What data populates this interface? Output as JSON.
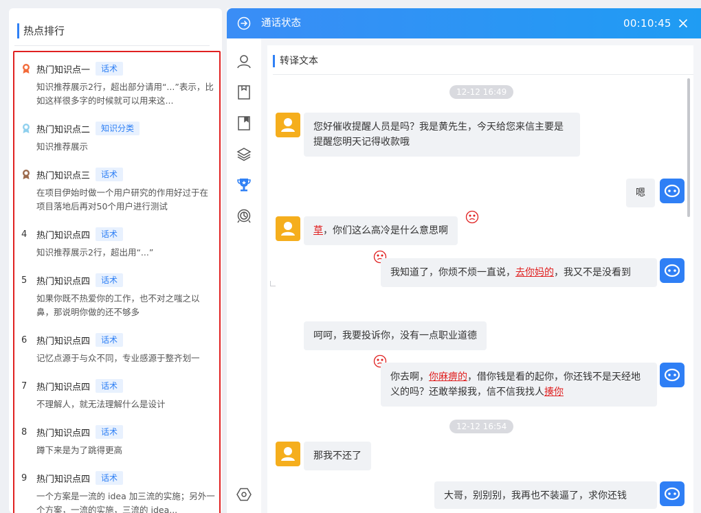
{
  "hot_ranking": {
    "title": "热点排行",
    "items": [
      {
        "rank": "",
        "medal": "gold-medal-icon",
        "title": "热门知识点一",
        "tag": "话术",
        "desc": "知识推荐展示2行，超出部分请用“...”表示，比如这样很多字的时候就可以用来这..."
      },
      {
        "rank": "",
        "medal": "silver-medal-icon",
        "title": "热门知识点二",
        "tag": "知识分类",
        "desc": "知识推荐展示"
      },
      {
        "rank": "",
        "medal": "bronze-medal-icon",
        "title": "热门知识点三",
        "tag": "话术",
        "desc": "在项目伊始时做一个用户研究的作用好过于在项目落地后再对50个用户进行测试"
      },
      {
        "rank": "4",
        "title": "热门知识点四",
        "tag": "话术",
        "desc": "知识推荐展示2行，超出用“...”"
      },
      {
        "rank": "5",
        "title": "热门知识点四",
        "tag": "话术",
        "desc": "如果你既不热爱你的工作，也不对之嗤之以鼻，那说明你做的还不够多"
      },
      {
        "rank": "6",
        "title": "热门知识点四",
        "tag": "话术",
        "desc": "记忆点源于与众不同，专业感源于整齐划一"
      },
      {
        "rank": "7",
        "title": "热门知识点四",
        "tag": "话术",
        "desc": "不理解人，就无法理解什么是设计"
      },
      {
        "rank": "8",
        "title": "热门知识点四",
        "tag": "话术",
        "desc": "蹲下来是为了跳得更高"
      },
      {
        "rank": "9",
        "title": "热门知识点四",
        "tag": "话术",
        "desc": "一个方案是一流的 idea 加三流的实施；另外一个方案，一流的实施，三流的 idea..."
      }
    ]
  },
  "call": {
    "title": "通话状态",
    "timer": "00:10:45",
    "colors": {
      "header_start": "#3a8df6",
      "header_end": "#1f9cf3",
      "accent": "#2f80f5",
      "sensitive": "#e02020"
    }
  },
  "toolbar": {
    "icons": [
      "user-icon",
      "bookmark-icon",
      "book-icon",
      "layers-icon",
      "trophy-icon",
      "headset-icon",
      "settings-hex-icon"
    ]
  },
  "transcript": {
    "title": "转译文本",
    "time_1": "12-12 16:49",
    "time_2": "12-12 16:54",
    "messages": [
      {
        "speaker": "customer",
        "parts": [
          "您好催收提醒人员是吗？我是黄先生，今天给您来信主要是提醒您明天记得收款哦"
        ]
      },
      {
        "speaker": "agent",
        "parts": [
          "嗯"
        ]
      },
      {
        "speaker": "customer",
        "sensitive": true,
        "parts": [
          "草",
          "，你们这么高冷是什么意思啊"
        ]
      },
      {
        "speaker": "agent",
        "sensitive": true,
        "parts": [
          "我知道了，你烦不烦一直说，",
          "去你妈的",
          "，我又不是没看到"
        ]
      },
      {
        "speaker": "customer",
        "parts": [
          "呵呵，我要投诉你，没有一点职业道德"
        ]
      },
      {
        "speaker": "agent",
        "sensitive": true,
        "parts": [
          "你去啊，",
          "你麻痹的",
          "，借你钱是看的起你，你还钱不是天经地义的吗？还敢举报我，信不信我找人",
          "揍你"
        ]
      },
      {
        "speaker": "customer",
        "parts": [
          "那我不还了"
        ]
      },
      {
        "speaker": "agent",
        "parts": [
          "大哥，别别别，我再也不装逼了，求你还钱"
        ]
      }
    ]
  }
}
